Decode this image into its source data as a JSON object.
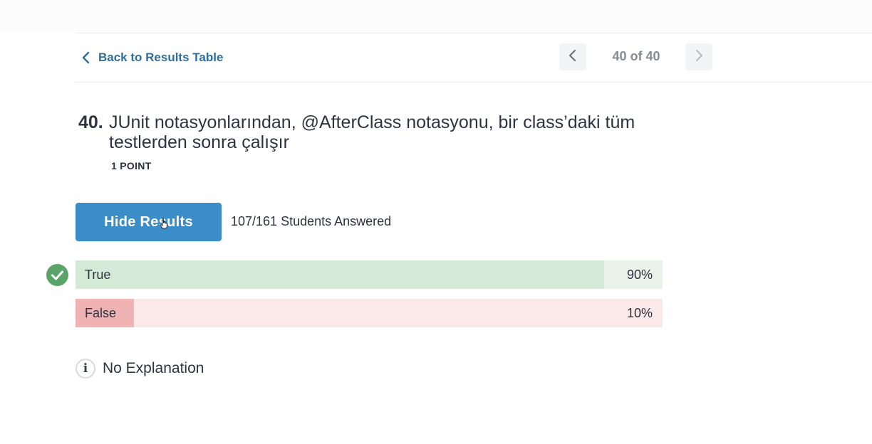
{
  "nav": {
    "back_label": "Back to Results Table",
    "pager_label": "40 of 40",
    "prev_icon": "chevron-left-icon",
    "next_icon": "chevron-right-icon"
  },
  "question": {
    "number": "40.",
    "text": "JUnit notasyonlarından, @AfterClass notasyonu, bir class’daki tüm testlerden sonra çalışır",
    "points": "1 POINT"
  },
  "results": {
    "hide_button_label": "Hide Results",
    "answered_text": "107/161 Students Answered",
    "answers": [
      {
        "label": "True",
        "percent_label": "90%",
        "percent": 90,
        "correct": true,
        "color": "#d4e9d6"
      },
      {
        "label": "False",
        "percent_label": "10%",
        "percent": 10,
        "correct": false,
        "color": "#efb3b3"
      }
    ]
  },
  "explanation": {
    "icon": "info-icon",
    "text": "No Explanation"
  },
  "colors": {
    "accent": "#3b8dc8",
    "link": "#2d6e9e",
    "correct": "#5aa469"
  }
}
